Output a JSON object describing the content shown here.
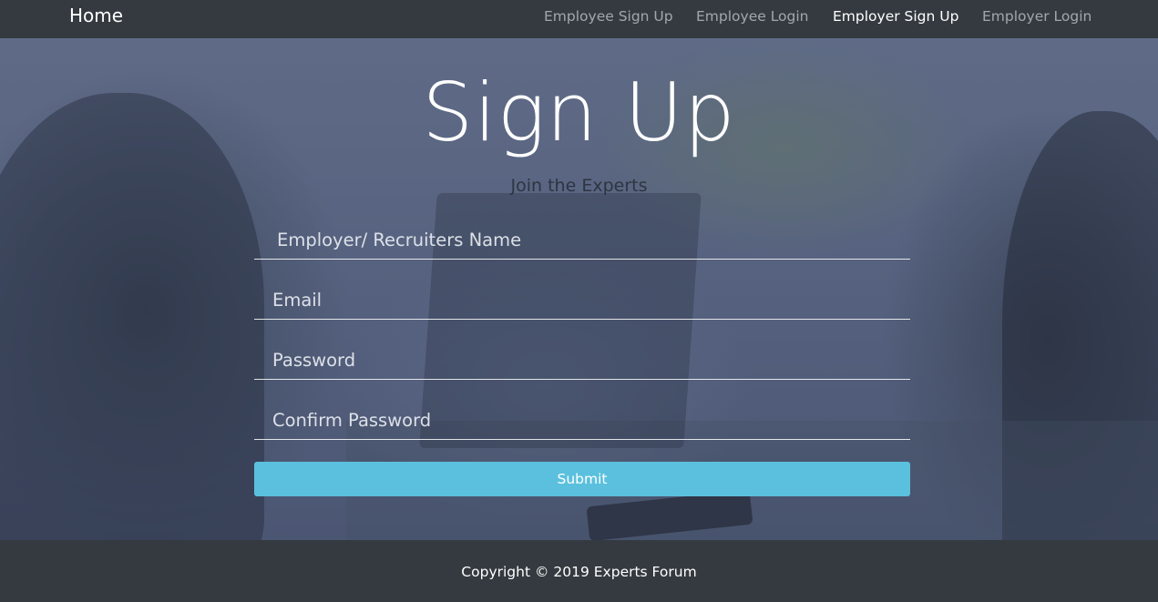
{
  "navbar": {
    "brand": "Home",
    "links": [
      {
        "label": "Employee Sign Up",
        "active": false
      },
      {
        "label": "Employee Login",
        "active": false
      },
      {
        "label": "Employer Sign Up",
        "active": true
      },
      {
        "label": "Employer Login",
        "active": false
      }
    ]
  },
  "hero": {
    "title": "Sign Up",
    "subtitle": "Join the Experts"
  },
  "form": {
    "fields": [
      {
        "placeholder": "Employer/ Recruiters Name",
        "type": "text"
      },
      {
        "placeholder": "Email",
        "type": "email"
      },
      {
        "placeholder": "Password",
        "type": "password"
      },
      {
        "placeholder": "Confirm Password",
        "type": "password"
      }
    ],
    "submit_label": "Submit"
  },
  "footer": {
    "copyright": "Copyright © 2019 Experts Forum"
  },
  "colors": {
    "navbar_bg": "#343a40",
    "submit_bg": "#5bc0de",
    "hero_overlay": "#56627f"
  }
}
